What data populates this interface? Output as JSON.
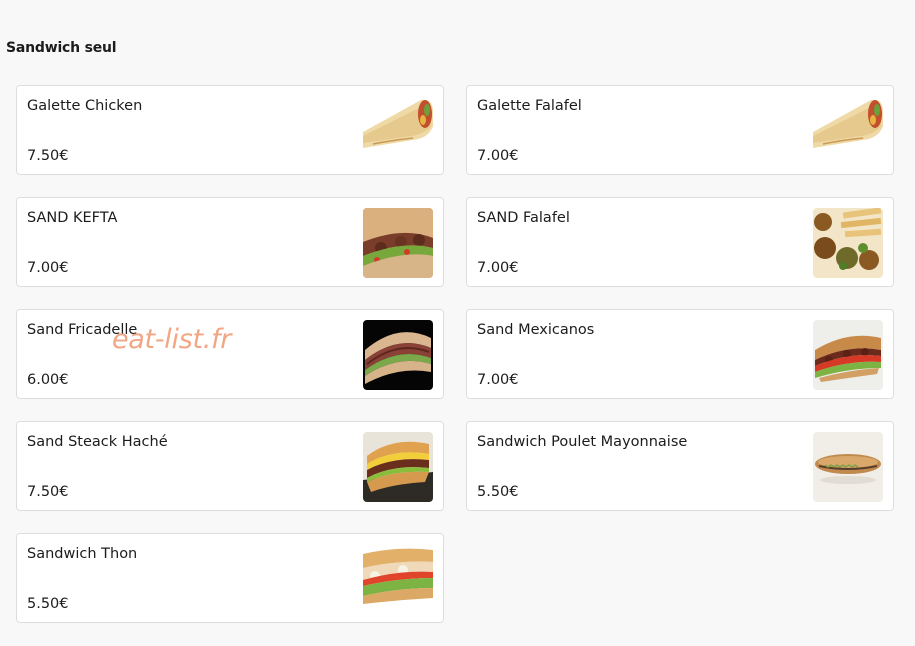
{
  "section": {
    "title": "Sandwich seul"
  },
  "items": [
    {
      "name": "Galette Chicken",
      "price": "7.50€",
      "image": "wrap-image"
    },
    {
      "name": "Galette Falafel",
      "price": "7.00€",
      "image": "wrap-image"
    },
    {
      "name": "SAND KEFTA",
      "price": "7.00€",
      "image": "kefta-sandwich-image"
    },
    {
      "name": "SAND Falafel",
      "price": "7.00€",
      "image": "falafel-image"
    },
    {
      "name": "Sand Fricadelle",
      "price": "6.00€",
      "image": "fricadelle-sandwich-image"
    },
    {
      "name": "Sand Mexicanos",
      "price": "7.00€",
      "image": "mexicanos-sandwich-image"
    },
    {
      "name": "Sand Steack Haché",
      "price": "7.50€",
      "image": "steak-sandwich-image"
    },
    {
      "name": "Sandwich Poulet Mayonnaise",
      "price": "5.50€",
      "image": "chicken-mayo-sandwich-image"
    },
    {
      "name": "Sandwich Thon",
      "price": "5.50€",
      "image": "tuna-sandwich-image"
    }
  ],
  "watermark": "eat-list.fr"
}
